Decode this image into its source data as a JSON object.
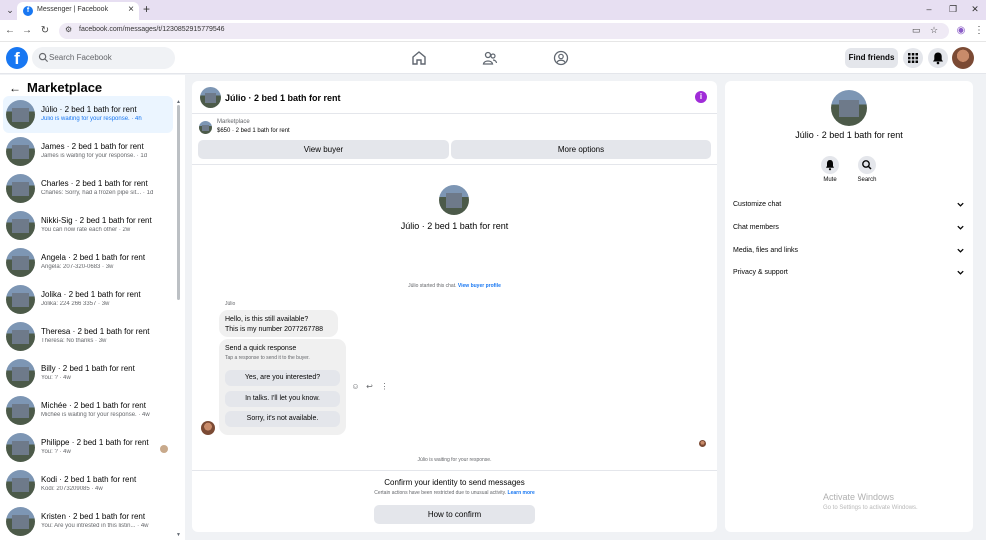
{
  "browser": {
    "tab_title": "Messenger | Facebook",
    "url": "facebook.com/messages/t/1230852915779546"
  },
  "fb": {
    "search_placeholder": "Search Facebook",
    "find_friends": "Find friends"
  },
  "sidebar": {
    "title": "Marketplace",
    "conversations": [
      {
        "name": "Júlio · 2 bed 1 bath for rent",
        "preview": "Júlio is waiting for your response. · 4h"
      },
      {
        "name": "James · 2 bed 1 bath for rent",
        "preview": "James is waiting for your response. · 1d"
      },
      {
        "name": "Charles · 2 bed 1 bath for rent",
        "preview": "Charles: Sorry, had a frozen pipe sit... · 1d"
      },
      {
        "name": "Nikki-Sig · 2 bed 1 bath for rent",
        "preview": "You can now rate each other · 2w"
      },
      {
        "name": "Angela · 2 bed 1 bath for rent",
        "preview": "Angela: 207-320-0683 · 3w"
      },
      {
        "name": "Jolika · 2 bed 1 bath for rent",
        "preview": "Jolika: 224 266 3357 · 3w"
      },
      {
        "name": "Theresa · 2 bed 1 bath for rent",
        "preview": "Theresa: No thanks · 3w"
      },
      {
        "name": "Billy · 2 bed 1 bath for rent",
        "preview": "You: ? · 4w"
      },
      {
        "name": "Michée · 2 bed 1 bath for rent",
        "preview": "Michée is waiting for your response. · 4w"
      },
      {
        "name": "Philippe · 2 bed 1 bath for rent",
        "preview": "You: ? · 4w"
      },
      {
        "name": "Kodi · 2 bed 1 bath for rent",
        "preview": "Kodi: 2073209085 · 4w"
      },
      {
        "name": "Kristen · 2 bed 1 bath for rent",
        "preview": "You: Are you intrested in this listin... · 4w"
      }
    ]
  },
  "chat": {
    "title": "Júlio · 2 bed 1 bath for rent",
    "marketplace_label": "Marketplace",
    "listing_price": "$650 · 2 bed 1 bath for rent",
    "view_buyer": "View buyer",
    "more_options": "More options",
    "hero_title": "Júlio · 2 bed 1 bath for rent",
    "started_text": "Júlio started this chat.",
    "view_buyer_profile": "View buyer profile",
    "sender_name": "Júlio",
    "message_line1": "Hello, is this still available?",
    "message_line2": "This is my number 2077267788",
    "quick_title": "Send a quick response",
    "quick_sub": "Tap a response to send it to the buyer.",
    "quick_responses": [
      "Yes, are you interested?",
      "In talks. I'll let you know.",
      "Sorry, it's not available."
    ],
    "waiting": "Júlio is waiting for your response.",
    "confirm_title": "Confirm your identity to send messages",
    "confirm_sub": "Certain actions have been restricted due to unusual activity.",
    "learn_more": "Learn more",
    "how_to_confirm": "How to confirm"
  },
  "right_panel": {
    "title": "Júlio · 2 bed 1 bath for rent",
    "mute": "Mute",
    "search": "Search",
    "sections": [
      "Customize chat",
      "Chat members",
      "Media, files and links",
      "Privacy & support"
    ]
  },
  "watermark": {
    "title": "Activate Windows",
    "sub": "Go to Settings to activate Windows."
  },
  "colors": {
    "fb_blue": "#1877f2",
    "active_row": "#ebf5ff",
    "info_purple": "#a02cd8"
  }
}
